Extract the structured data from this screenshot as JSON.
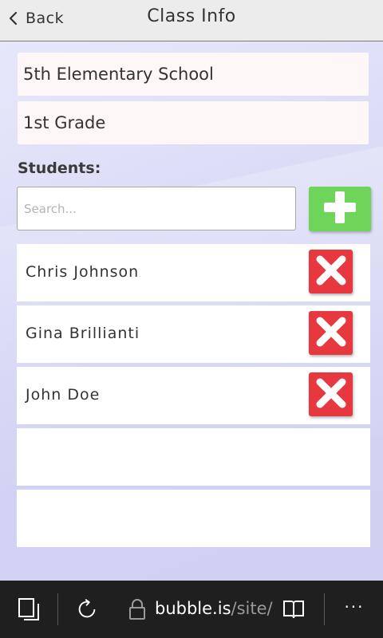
{
  "header": {
    "back_label": "Back",
    "title": "Class Info"
  },
  "class_info": {
    "school": "5th Elementary School",
    "grade": "1st Grade"
  },
  "students": {
    "heading": "Students:",
    "search_placeholder": "Search...",
    "items": [
      {
        "name": "Chris Johnson"
      },
      {
        "name": "Gina Brillianti"
      },
      {
        "name": "John Doe"
      }
    ],
    "empty_rows": 2
  },
  "browser_bar": {
    "url_host": "bubble.is",
    "url_path": "/site/",
    "more": "···"
  },
  "colors": {
    "add_button": "#6fd45a",
    "remove_button": "#e6383e",
    "header_bg": "#ececec",
    "browser_bar_bg": "#1f1f1f"
  },
  "icons": {
    "back": "chevron-left-icon",
    "add": "plus-icon",
    "remove": "x-icon",
    "tabs": "tabs-icon",
    "refresh": "refresh-icon",
    "lock": "lock-icon",
    "reading": "reading-view-icon",
    "more": "more-icon"
  }
}
